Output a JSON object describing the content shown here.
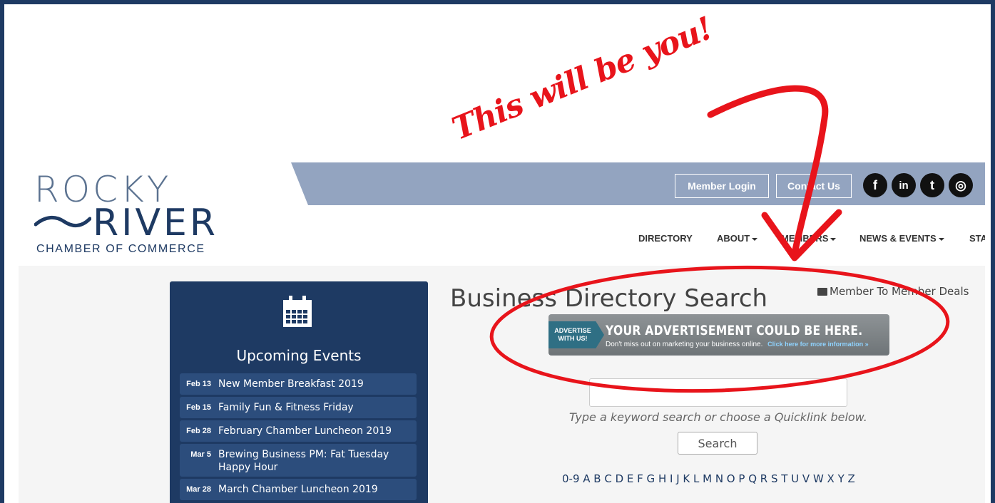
{
  "header": {
    "logo": {
      "line1": "ROCKY",
      "line2": "RIVER",
      "line3": "CHAMBER OF COMMERCE"
    },
    "topbar": {
      "member_login": "Member Login",
      "contact_us": "Contact Us"
    },
    "social": [
      {
        "icon": "facebook-icon",
        "glyph": "f"
      },
      {
        "icon": "linkedin-icon",
        "glyph": "in"
      },
      {
        "icon": "twitter-icon",
        "glyph": "t"
      },
      {
        "icon": "instagram-icon",
        "glyph": "◎"
      }
    ],
    "nav": {
      "directory": "DIRECTORY",
      "about": "ABOUT",
      "members": "MEMBERS",
      "news_events": "NEWS & EVENTS",
      "more": "STA"
    }
  },
  "events": {
    "title": "Upcoming Events",
    "items": [
      {
        "date": "Feb 13",
        "title": "New Member Breakfast 2019"
      },
      {
        "date": "Feb 15",
        "title": "Family Fun & Fitness Friday"
      },
      {
        "date": "Feb 28",
        "title": "February Chamber Luncheon 2019"
      },
      {
        "date": "Mar 5",
        "title": "Brewing Business PM: Fat Tuesday Happy Hour"
      },
      {
        "date": "Mar 28",
        "title": "March Chamber Luncheon 2019"
      }
    ]
  },
  "directory": {
    "title": "Business Directory Search",
    "deals_link": "Member To Member Deals",
    "ad": {
      "tag_line1": "ADVERTISE",
      "tag_line2": "WITH US!",
      "headline": "YOUR ADVERTISEMENT COULD BE HERE.",
      "subtext": "Don't miss out on marketing your business online.",
      "link": "Click here for more information »"
    },
    "search_placeholder": "",
    "hint": "Type a keyword search or choose a Quicklink below.",
    "search_button": "Search",
    "alphabet": "0-9 A B C D E F G H I J K L M N O P Q R S T U V W X Y Z"
  },
  "annotation": {
    "text": "This will be you!",
    "color": "#e8141b"
  }
}
